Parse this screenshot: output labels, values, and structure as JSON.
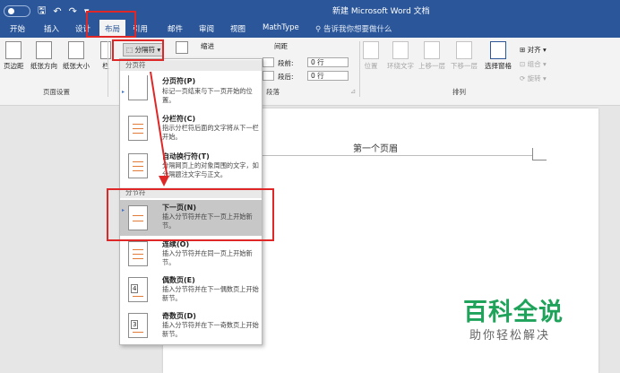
{
  "window": {
    "title": "新建 Microsoft Word 文档"
  },
  "quick_access": {
    "icons": [
      "autosave-toggle",
      "save-icon",
      "undo-icon",
      "redo-icon",
      "customize-icon"
    ]
  },
  "tabs": [
    "开始",
    "插入",
    "设计",
    "布局",
    "引用",
    "邮件",
    "审阅",
    "视图",
    "MathType"
  ],
  "active_tab": "布局",
  "tell_me": "告诉我你想要做什么",
  "ribbon": {
    "page_setup": {
      "margins": "页边距",
      "orientation": "纸张方向",
      "size": "纸张大小",
      "columns": "栏",
      "breaks_button": "分隔符",
      "group_label": "页面设置"
    },
    "paragraph": {
      "indent_label": "缩进",
      "spacing_label": "间距",
      "before_label": "段前:",
      "before_value": "0 行",
      "after_label": "段后:",
      "after_value": "0 行",
      "group_label": "段落"
    },
    "arrange": {
      "position": "位置",
      "wrap_text": "环绕文字",
      "bring_forward": "上移一层",
      "send_backward": "下移一层",
      "selection_pane": "选择窗格",
      "align": "对齐",
      "group": "组合",
      "rotate": "旋转",
      "group_label": "排列"
    }
  },
  "breaks_menu": {
    "page_breaks_header": "分页符",
    "section_breaks_header": "分节符",
    "items": [
      {
        "title": "分页符(P)",
        "desc": "标记一页结束与下一页开始的位置。"
      },
      {
        "title": "分栏符(C)",
        "desc": "指示分栏符后面的文字将从下一栏开始。"
      },
      {
        "title": "自动换行符(T)",
        "desc": "分隔网页上的对象周围的文字，如分隔题注文字与正文。"
      },
      {
        "title": "下一页(N)",
        "desc": "插入分节符并在下一页上开始新节。"
      },
      {
        "title": "连续(O)",
        "desc": "插入分节符并在同一页上开始新节。"
      },
      {
        "title": "偶数页(E)",
        "desc": "插入分节符并在下一偶数页上开始新节。"
      },
      {
        "title": "奇数页(D)",
        "desc": "插入分节符并在下一奇数页上开始新节。"
      }
    ]
  },
  "document": {
    "header_text": "第一个页眉"
  },
  "watermark": {
    "title": "百科全说",
    "subtitle": "助你轻松解决"
  },
  "colors": {
    "word_blue": "#2b579a",
    "highlight": "#e02727",
    "watermark_green": "#1fa35b"
  }
}
